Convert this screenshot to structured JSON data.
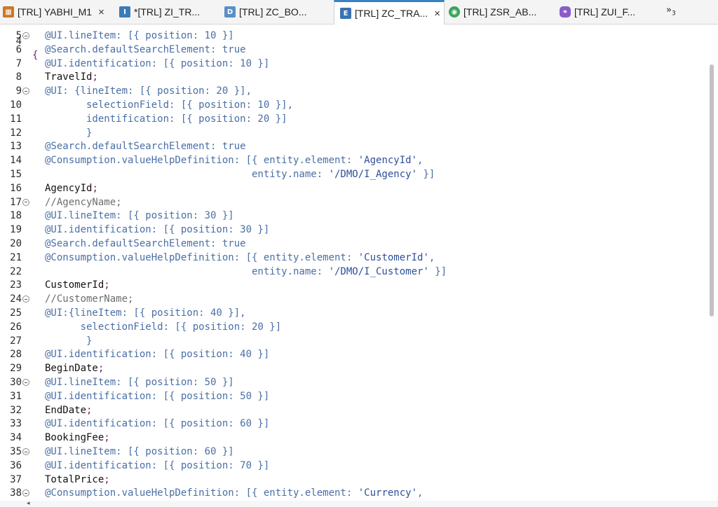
{
  "tabs": [
    {
      "label": "[TRL] YABHI_M1",
      "icon": "table-icon",
      "close": "×",
      "active": false
    },
    {
      "label": "*[TRL] ZI_TR...",
      "icon": "interface-view-icon",
      "active": false
    },
    {
      "label": "[TRL] ZC_BO...",
      "icon": "data-definition-icon",
      "active": false
    },
    {
      "label": "[TRL] ZC_TRA...",
      "icon": "metadata-extension-icon",
      "close": "×",
      "active": true
    },
    {
      "label": "[TRL] ZSR_AB...",
      "icon": "service-definition-icon",
      "active": false
    },
    {
      "label": "[TRL] ZUI_F...",
      "icon": "service-binding-icon",
      "active": false
    }
  ],
  "tab_overflow": {
    "symbol": "»",
    "count": "3"
  },
  "editor": {
    "partial_line": {
      "number": "4",
      "code": "{"
    },
    "lines": [
      {
        "n": "5",
        "fold": true,
        "text": "@UI.lineItem: [{ position: 10 }]",
        "kind": "ann"
      },
      {
        "n": "6",
        "fold": false,
        "text": "@Search.defaultSearchElement: true",
        "kind": "ann"
      },
      {
        "n": "7",
        "fold": false,
        "text": "@UI.identification: [{ position: 10 }]",
        "kind": "ann"
      },
      {
        "n": "8",
        "fold": false,
        "text": "TravelId",
        "kind": "field"
      },
      {
        "n": "9",
        "fold": true,
        "text": "@UI: {lineItem: [{ position: 20 }],",
        "kind": "ann"
      },
      {
        "n": "10",
        "fold": false,
        "text": "       selectionField: [{ position: 10 }],",
        "kind": "ann"
      },
      {
        "n": "11",
        "fold": false,
        "text": "       identification: [{ position: 20 }]",
        "kind": "ann"
      },
      {
        "n": "12",
        "fold": false,
        "text": "       }",
        "kind": "ann"
      },
      {
        "n": "13",
        "fold": false,
        "text": "@Search.defaultSearchElement: true",
        "kind": "ann"
      },
      {
        "n": "14",
        "fold": false,
        "text": "@Consumption.valueHelpDefinition: [{ entity.element: 'AgencyId',",
        "kind": "ann"
      },
      {
        "n": "15",
        "fold": false,
        "text": "                                   entity.name: '/DMO/I_Agency' }]",
        "kind": "ann"
      },
      {
        "n": "16",
        "fold": false,
        "text": "AgencyId",
        "kind": "field"
      },
      {
        "n": "17",
        "fold": true,
        "text": "//AgencyName;",
        "kind": "comment"
      },
      {
        "n": "18",
        "fold": false,
        "text": "@UI.lineItem: [{ position: 30 }]",
        "kind": "ann"
      },
      {
        "n": "19",
        "fold": false,
        "text": "@UI.identification: [{ position: 30 }]",
        "kind": "ann"
      },
      {
        "n": "20",
        "fold": false,
        "text": "@Search.defaultSearchElement: true",
        "kind": "ann"
      },
      {
        "n": "21",
        "fold": false,
        "text": "@Consumption.valueHelpDefinition: [{ entity.element: 'CustomerId',",
        "kind": "ann"
      },
      {
        "n": "22",
        "fold": false,
        "text": "                                   entity.name: '/DMO/I_Customer' }]",
        "kind": "ann"
      },
      {
        "n": "23",
        "fold": false,
        "text": "CustomerId",
        "kind": "field"
      },
      {
        "n": "24",
        "fold": true,
        "text": "//CustomerName;",
        "kind": "comment"
      },
      {
        "n": "25",
        "fold": false,
        "text": "@UI:{lineItem: [{ position: 40 }],",
        "kind": "ann"
      },
      {
        "n": "26",
        "fold": false,
        "text": "      selectionField: [{ position: 20 }]",
        "kind": "ann"
      },
      {
        "n": "27",
        "fold": false,
        "text": "       }",
        "kind": "ann"
      },
      {
        "n": "28",
        "fold": false,
        "text": "@UI.identification: [{ position: 40 }]",
        "kind": "ann"
      },
      {
        "n": "29",
        "fold": false,
        "text": "BeginDate",
        "kind": "field"
      },
      {
        "n": "30",
        "fold": true,
        "text": "@UI.lineItem: [{ position: 50 }]",
        "kind": "ann"
      },
      {
        "n": "31",
        "fold": false,
        "text": "@UI.identification: [{ position: 50 }]",
        "kind": "ann"
      },
      {
        "n": "32",
        "fold": false,
        "text": "EndDate",
        "kind": "field"
      },
      {
        "n": "33",
        "fold": false,
        "text": "@UI.identification: [{ position: 60 }]",
        "kind": "ann"
      },
      {
        "n": "34",
        "fold": false,
        "text": "BookingFee",
        "kind": "field"
      },
      {
        "n": "35",
        "fold": true,
        "text": "@UI.lineItem: [{ position: 60 }]",
        "kind": "ann"
      },
      {
        "n": "36",
        "fold": false,
        "text": "@UI.identification: [{ position: 70 }]",
        "kind": "ann"
      },
      {
        "n": "37",
        "fold": false,
        "text": "TotalPrice",
        "kind": "field"
      },
      {
        "n": "38",
        "fold": true,
        "text": "@Consumption.valueHelpDefinition: [{ entity.element: 'Currency',",
        "kind": "ann"
      }
    ],
    "semicolon": ";"
  },
  "colors": {
    "annotation": "#4a6fa5",
    "string": "#2e4f99",
    "comment": "#6d6d6d",
    "identifier": "#111111",
    "semicolon": "#7a1d6e",
    "active_tab_accent": "#3b82c4"
  }
}
